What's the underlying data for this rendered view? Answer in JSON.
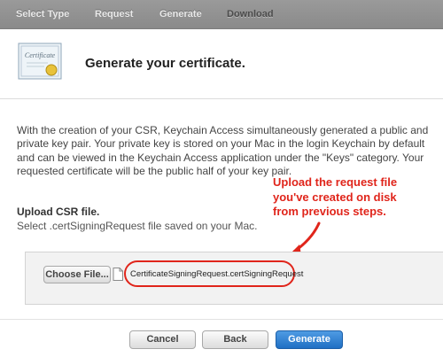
{
  "steps": [
    "Select Type",
    "Request",
    "Generate",
    "Download"
  ],
  "heading": "Generate your certificate.",
  "description": "With the creation of your CSR, Keychain Access simultaneously generated a public and private key pair. Your private key is stored on your Mac in the login Keychain by default and can be viewed in the Keychain Access application under the \"Keys\" category. Your requested certificate will be the public half of your key pair.",
  "upload": {
    "title": "Upload CSR file.",
    "subtitle": "Select .certSigningRequest file saved on your Mac.",
    "choose_label": "Choose File...",
    "filename": "CertificateSigningRequest.certSigningRequest"
  },
  "callout": {
    "line1": "Upload the request file",
    "line2": "you've created on disk",
    "line3": "from previous steps."
  },
  "icon": {
    "certificate_label": "Certificate"
  },
  "buttons": {
    "cancel": "Cancel",
    "back": "Back",
    "generate": "Generate"
  },
  "colors": {
    "accent_red": "#e0251b",
    "primary_blue": "#1f6fc4",
    "step_bar": "#8f8f8f"
  }
}
